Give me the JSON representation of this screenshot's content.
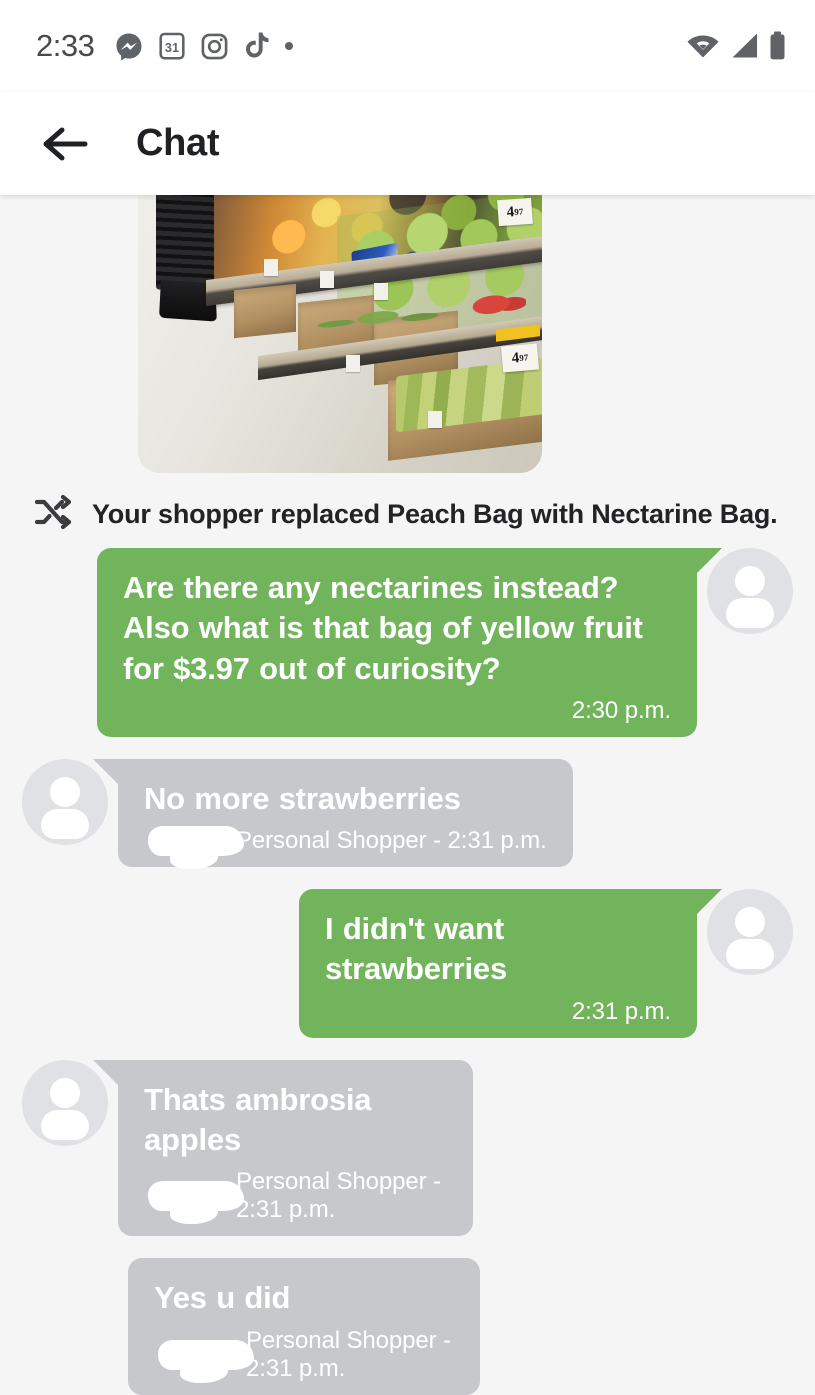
{
  "status_bar": {
    "time": "2:33",
    "left_icons": [
      "messenger-icon",
      "calendar-icon",
      "instagram-icon",
      "tiktok-icon",
      "dot-icon"
    ],
    "calendar_day": "31",
    "right_icons": [
      "wifi-icon",
      "cell-signal-icon",
      "battery-icon"
    ]
  },
  "app_bar": {
    "back_label": "Back",
    "title": "Chat"
  },
  "attachment": {
    "type": "photo",
    "alt": "Grocery store produce aisle with shelves of fruit and vegetables",
    "price_tag_1": "4",
    "price_tag_1_cents": "97",
    "price_tag_2": "4",
    "price_tag_2_cents": "97"
  },
  "system_notice": {
    "icon": "swap-icon",
    "text": "Your shopper replaced Peach Bag with Nectarine Bag."
  },
  "colors": {
    "outgoing_bubble": "#72b45c",
    "incoming_bubble": "#c6c8cc",
    "background": "#f5f5f5",
    "app_bar": "#ffffff",
    "avatar": "#e0e1e4",
    "text_on_bubble": "#ffffff"
  },
  "messages": [
    {
      "id": "m1",
      "direction": "outgoing",
      "text": "Are there any nectarines instead? Also what is that bag of yellow fruit for $3.97 out of curiosity?",
      "meta": "2:30 p.m.",
      "redacted_name": false,
      "avatar": true
    },
    {
      "id": "m2",
      "direction": "incoming",
      "text": "No more strawberries",
      "meta": "Personal Shopper - 2:31 p.m.",
      "redacted_name": true,
      "avatar": true
    },
    {
      "id": "m3",
      "direction": "outgoing",
      "text": "I didn't want strawberries",
      "meta": "2:31 p.m.",
      "redacted_name": false,
      "avatar": true
    },
    {
      "id": "m4",
      "direction": "incoming",
      "text": "Thats ambrosia apples",
      "meta": "Personal Shopper - 2:31 p.m.",
      "redacted_name": true,
      "avatar": true
    },
    {
      "id": "m5",
      "direction": "incoming",
      "text": "Yes u did",
      "meta": "Personal Shopper - 2:31 p.m.",
      "redacted_name": true,
      "avatar": false
    }
  ]
}
